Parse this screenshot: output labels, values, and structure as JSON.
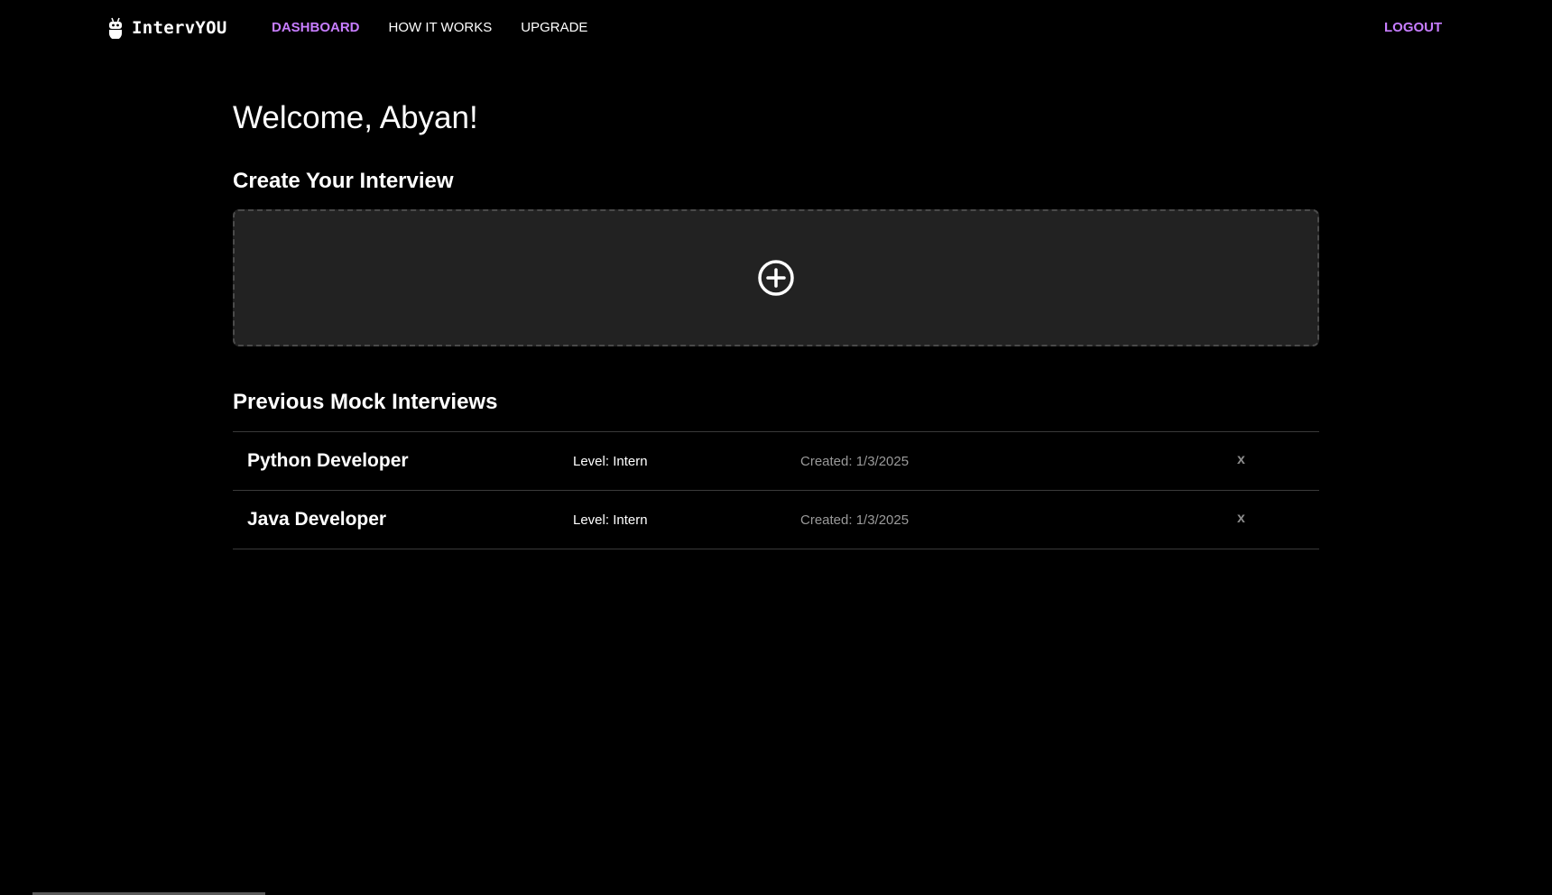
{
  "nav": {
    "brand": "IntervYOU",
    "links": [
      "DASHBOARD",
      "HOW IT WORKS",
      "UPGRADE"
    ],
    "logout": "LOGOUT",
    "accent_color": "#c77dff"
  },
  "main": {
    "welcome": "Welcome, Abyan!",
    "create_title": "Create Your Interview",
    "create_icon": "plus-circle-icon",
    "previous_title": "Previous Mock Interviews",
    "interviews": [
      {
        "title": "Python Developer",
        "level": "Level: Intern",
        "created": "Created: 1/3/2025",
        "delete": "x"
      },
      {
        "title": "Java Developer",
        "level": "Level: Intern",
        "created": "Created: 1/3/2025",
        "delete": "x"
      }
    ]
  }
}
